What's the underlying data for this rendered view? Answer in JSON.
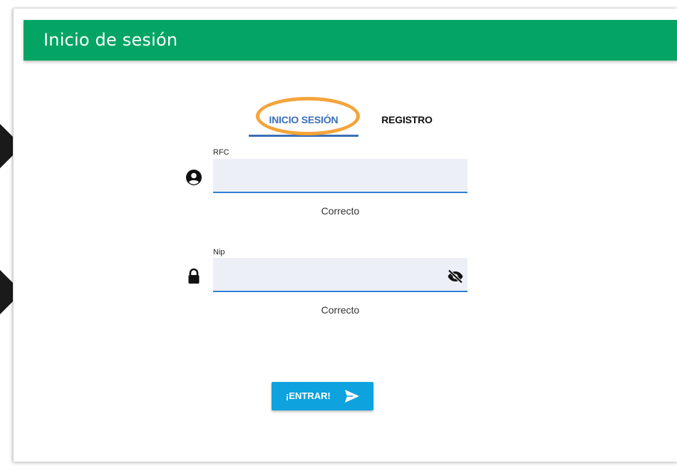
{
  "header": {
    "title": "Inicio de sesión"
  },
  "tabs": [
    {
      "label": "INICIO SESIÓN",
      "active": true
    },
    {
      "label": "REGISTRO",
      "active": false
    }
  ],
  "form": {
    "rfc": {
      "label": "RFC",
      "value": "",
      "help": "Correcto",
      "icon": "user-circle-icon"
    },
    "nip": {
      "label": "Nip",
      "value": "",
      "help": "Correcto",
      "icon": "lock-icon",
      "toggle_icon": "eye-slash-icon"
    }
  },
  "submit": {
    "label": "¡ENTRAR!",
    "icon": "send-icon"
  },
  "colors": {
    "header": "#04a564",
    "active_tab": "#3b6fb6",
    "highlight_ring": "#f4a43a",
    "input_underline": "#2f7fd6",
    "button": "#0ea2df"
  }
}
